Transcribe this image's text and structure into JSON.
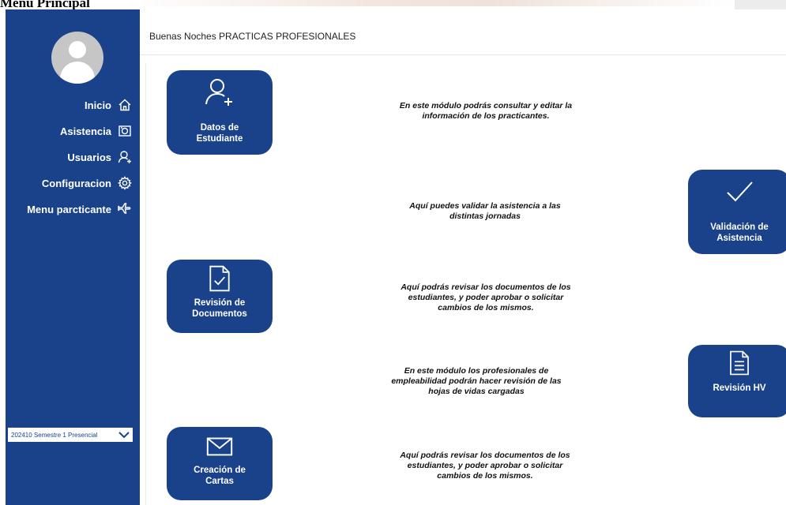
{
  "window": {
    "title": "Menú Principal"
  },
  "sidebar": {
    "items": [
      {
        "label": "Inicio",
        "icon": "home-icon"
      },
      {
        "label": "Asistencia",
        "icon": "camera-icon"
      },
      {
        "label": "Usuarios",
        "icon": "user-add-icon"
      },
      {
        "label": "Configuracion",
        "icon": "gear-icon"
      },
      {
        "label": "Menu parcticante",
        "icon": "airplane-icon"
      }
    ],
    "semester": "202410 Semestre 1 Presencial"
  },
  "header": {
    "greeting": "Buenas Noches PRACTICAS PROFESIONALES"
  },
  "modules": [
    {
      "card": "Datos de Estudiante",
      "card_lines": [
        "Datos de",
        "Estudiante"
      ],
      "icon": "user-add-icon",
      "description_lines": [
        "En este módulo podrás consultar y editar la",
        "información de los practicantes."
      ]
    },
    {
      "card": "Validación de Asistencia",
      "card_lines": [
        "Validación de",
        "Asistencia"
      ],
      "icon": "checkmark-icon",
      "description_lines": [
        "Aquí puedes validar la asistencia a las",
        "distintas jornadas"
      ]
    },
    {
      "card": "Revisión de Documentos",
      "card_lines": [
        "Revisión de",
        "Documentos"
      ],
      "icon": "document-check-icon",
      "description_lines": [
        "Aquí podrás revisar los documentos de los",
        "estudiantes, y poder aprobar o solicitar",
        "cambios de los mismos."
      ]
    },
    {
      "card": "Revisión HV",
      "card_lines": [
        "Revisión HV"
      ],
      "icon": "document-lines-icon",
      "description_lines": [
        "En este módulo los profesionales de",
        "empleabilidad podrán hacer revisión de las",
        "hojas de vidas cargadas"
      ]
    },
    {
      "card": "Creación de Cartas",
      "card_lines": [
        "Creación de",
        "Cartas"
      ],
      "icon": "envelope-icon",
      "description_lines": [
        "Aquí podrás revisar los documentos de los",
        "estudiantes, y poder aprobar o solicitar",
        "cambios de los mismos."
      ]
    }
  ],
  "colors": {
    "primary": "#1a428a",
    "avatar_bg": "#c6c6c6"
  }
}
